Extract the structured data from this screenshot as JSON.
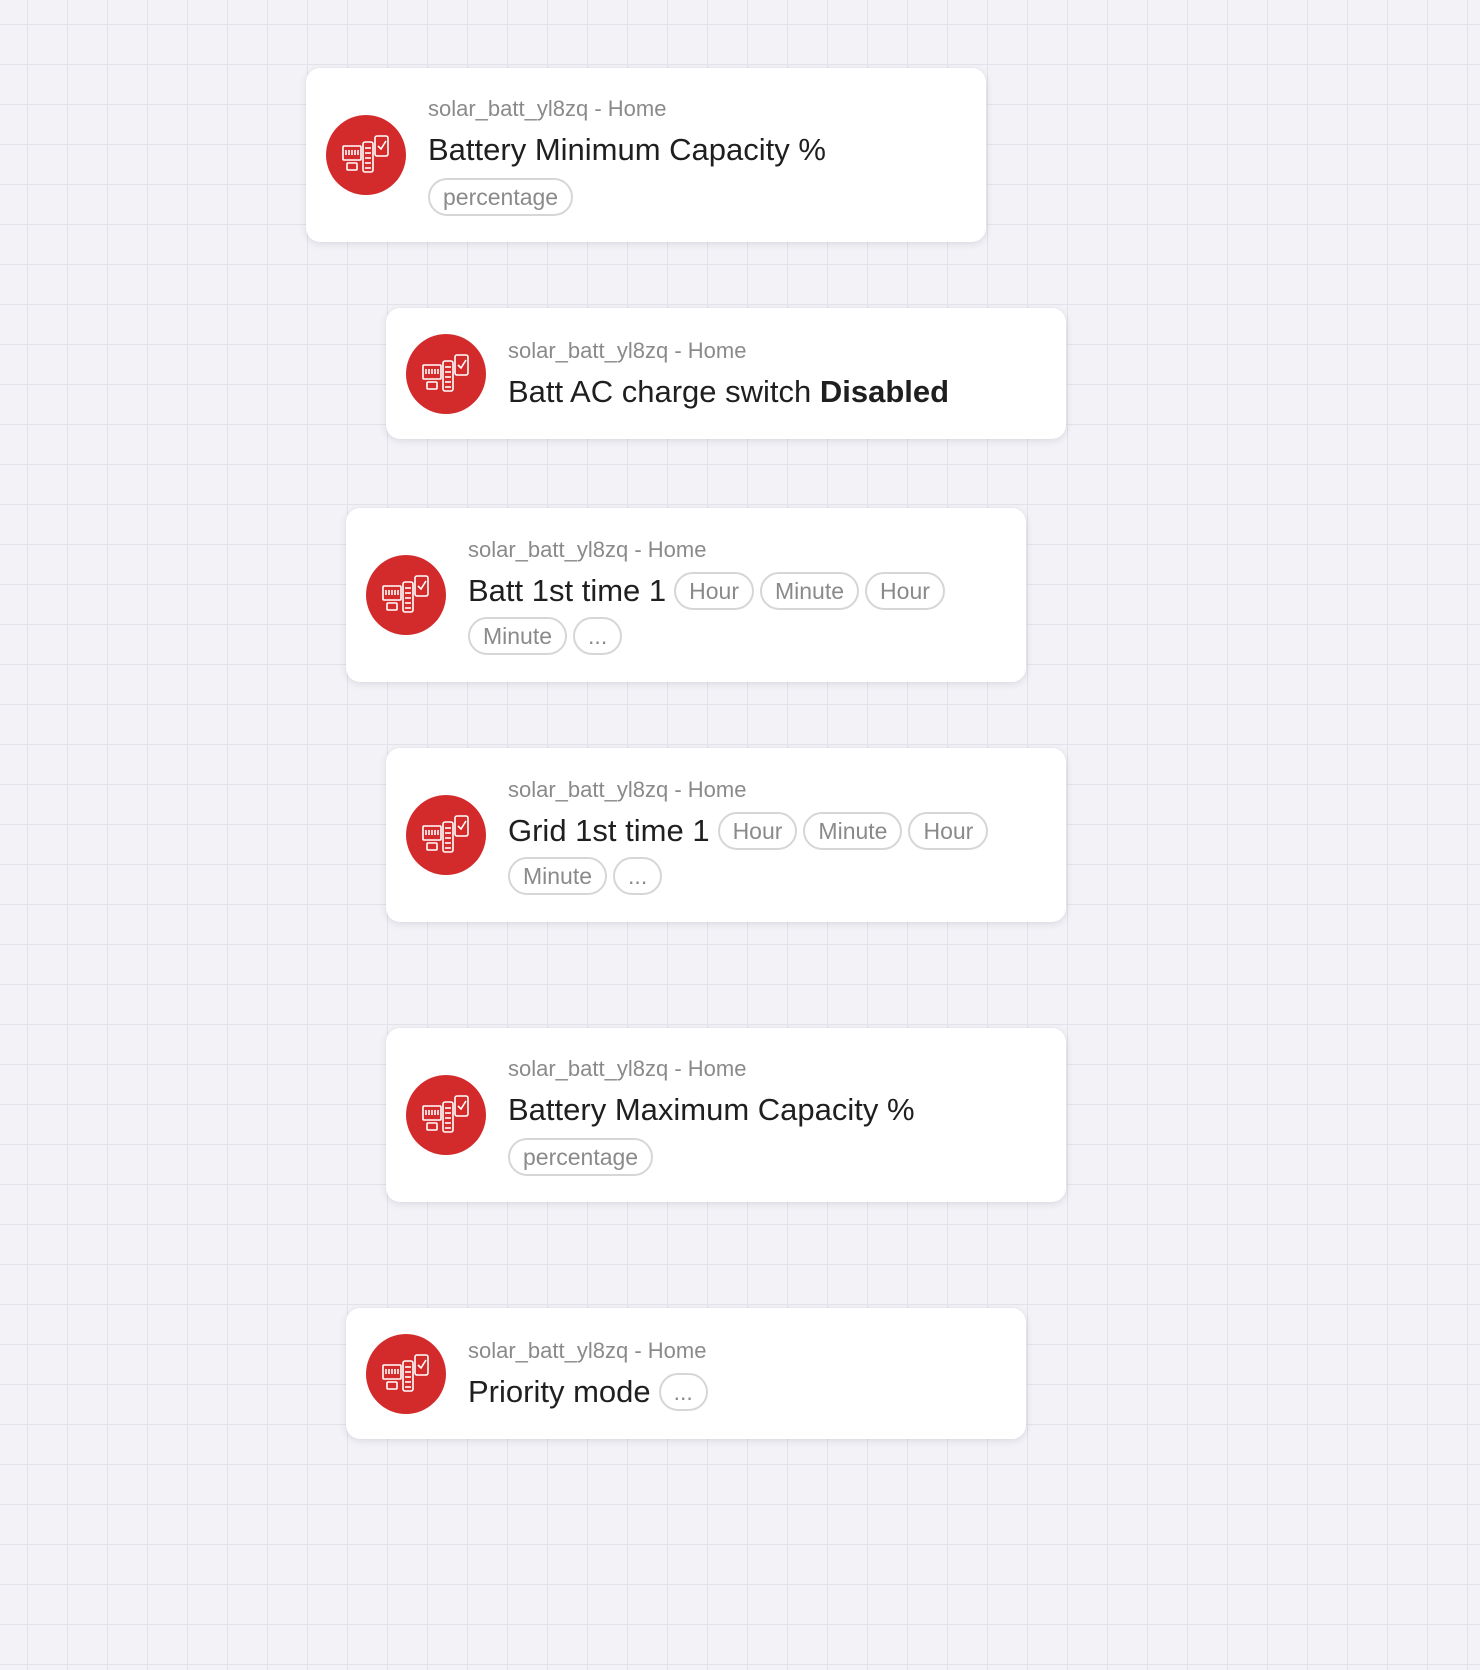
{
  "colors": {
    "canvas_background": "#f3f2f7",
    "grid_line": "#e3e2ea",
    "card_background": "#ffffff",
    "icon_background": "#d32b2b",
    "subtitle_text": "#8a8a8a",
    "title_text": "#1f1f1f",
    "chip_border": "#d6d6d6"
  },
  "cards": [
    {
      "icon": "solar-battery-icon",
      "subtitle": "solar_batt_yl8zq - Home",
      "title": "Battery Minimum Capacity %",
      "chips": [
        "percentage"
      ]
    },
    {
      "icon": "solar-battery-icon",
      "subtitle": "solar_batt_yl8zq - Home",
      "title": "Batt AC charge switch",
      "state": "Disabled",
      "chips": []
    },
    {
      "icon": "solar-battery-icon",
      "subtitle": "solar_batt_yl8zq - Home",
      "title": "Batt 1st time 1",
      "chips": [
        "Hour",
        "Minute",
        "Hour",
        "Minute",
        "..."
      ]
    },
    {
      "icon": "solar-battery-icon",
      "subtitle": "solar_batt_yl8zq - Home",
      "title": "Grid 1st time 1",
      "chips": [
        "Hour",
        "Minute",
        "Hour",
        "Minute",
        "..."
      ]
    },
    {
      "icon": "solar-battery-icon",
      "subtitle": "solar_batt_yl8zq - Home",
      "title": "Battery Maximum Capacity %",
      "chips": [
        "percentage"
      ]
    },
    {
      "icon": "solar-battery-icon",
      "subtitle": "solar_batt_yl8zq - Home",
      "title": "Priority mode",
      "chips": [
        "..."
      ]
    }
  ]
}
